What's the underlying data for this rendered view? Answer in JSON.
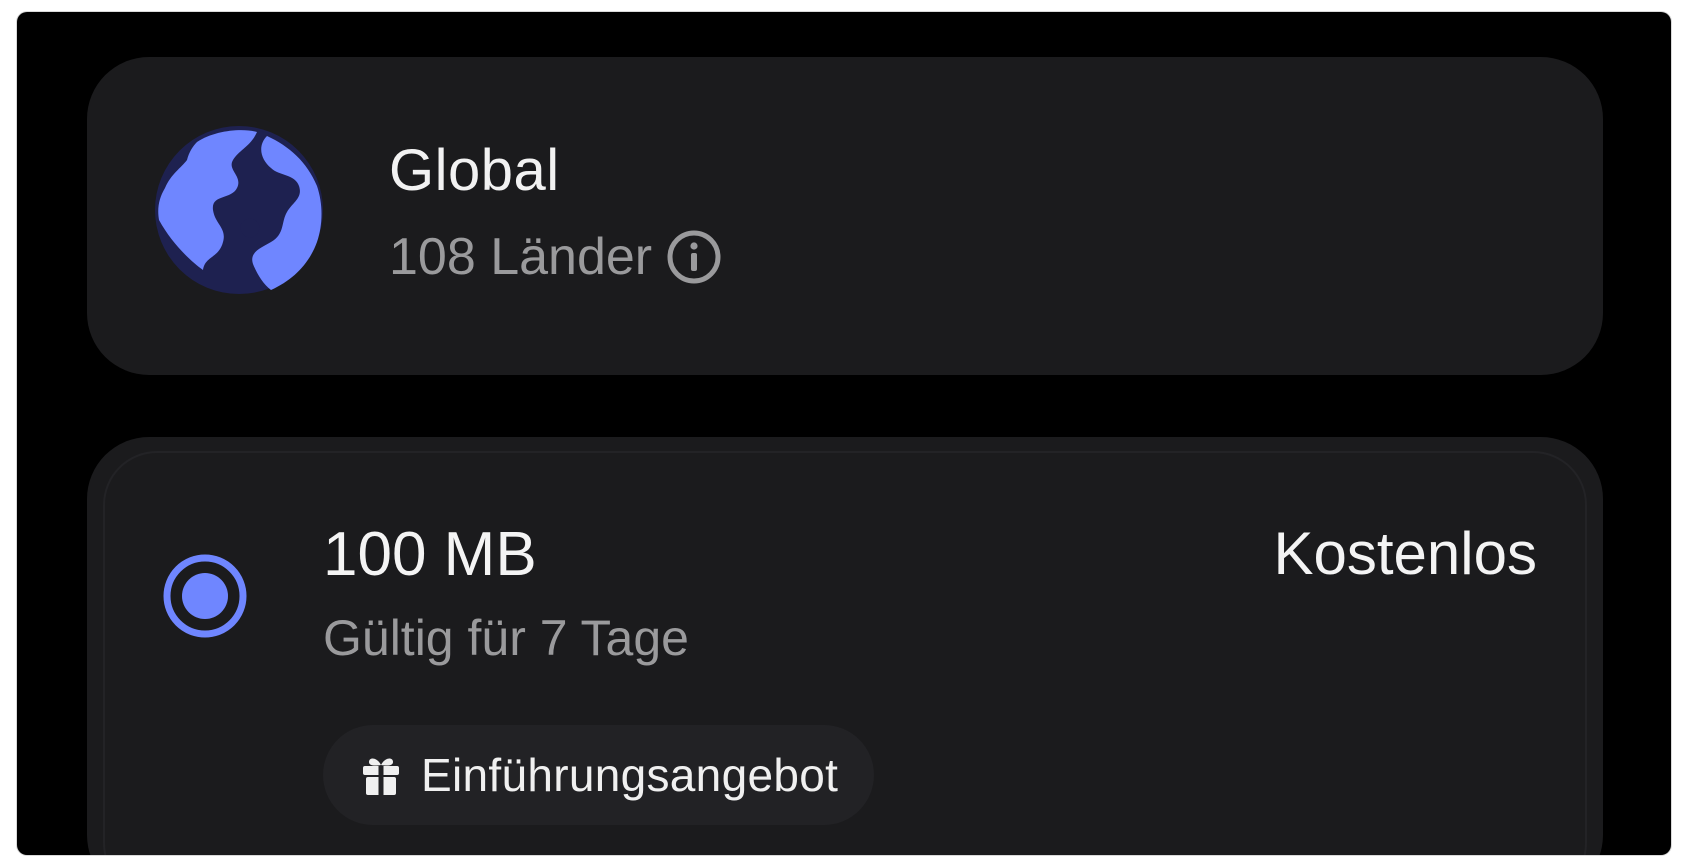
{
  "region": {
    "title": "Global",
    "countries": "108 Länder",
    "globe_icon": "globe-icon",
    "info_icon": "info-icon"
  },
  "plan": {
    "data_amount": "100 MB",
    "price": "Kostenlos",
    "validity": "Gültig für 7 Tage",
    "selected": true,
    "badge": {
      "icon": "gift-icon",
      "label": "Einführungsangebot"
    }
  },
  "colors": {
    "accent": "#6f86ff",
    "card_background": "#1b1b1d",
    "page_background": "#000000",
    "secondary_text": "#9a9a9c"
  }
}
